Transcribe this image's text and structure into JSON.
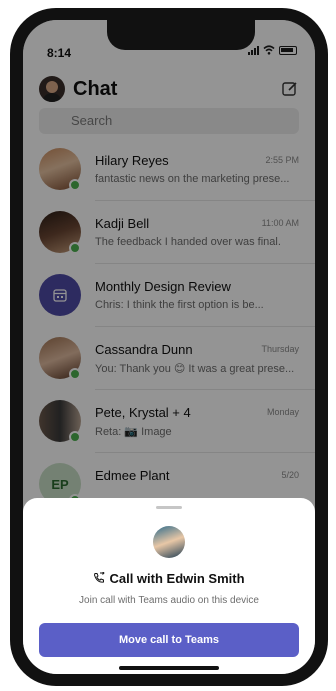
{
  "status": {
    "time": "8:14"
  },
  "header": {
    "title": "Chat"
  },
  "search": {
    "placeholder": "Search"
  },
  "chats": [
    {
      "name": "Hilary Reyes",
      "time": "2:55 PM",
      "preview": "fantastic news on the marketing prese...",
      "presence": "available"
    },
    {
      "name": "Kadji Bell",
      "time": "11:00 AM",
      "preview": "The feedback I handed over was final.",
      "presence": "available"
    },
    {
      "name": "Monthly Design Review",
      "time": "",
      "preview": "Chris: I think the first option is be...",
      "presence": "none"
    },
    {
      "name": "Cassandra Dunn",
      "time": "Thursday",
      "preview": "You: Thank you 😊 It was a great prese...",
      "presence": "available"
    },
    {
      "name": "Pete, Krystal + 4",
      "time": "Monday",
      "preview": "Reta: 📷 Image",
      "presence": "available"
    },
    {
      "name": "Edmee Plant",
      "time": "5/20",
      "preview": "",
      "initials": "EP",
      "presence": "available"
    }
  ],
  "call_sheet": {
    "title": "Call with Edwin Smith",
    "subtitle": "Join call with Teams audio on this device",
    "button_label": "Move call to Teams"
  },
  "colors": {
    "accent": "#5b5fc7",
    "presence": "#4cb04f"
  }
}
